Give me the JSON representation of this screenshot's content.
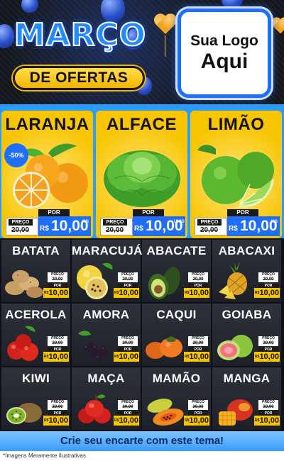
{
  "header": {
    "month": "MARÇO",
    "subtitle": "DE OFERTAS",
    "logo_line1": "Sua Logo",
    "logo_line2": "Aqui"
  },
  "featured": [
    {
      "name": "LARANJA",
      "discount": "-50%",
      "preco_label": "PREÇO",
      "old_price": "20,00",
      "por_label": "POR",
      "currency": "R$",
      "price": "10,00",
      "unit": "KG",
      "icon": "orange-fruit"
    },
    {
      "name": "ALFACE",
      "preco_label": "PREÇO",
      "old_price": "20,00",
      "por_label": "POR",
      "currency": "R$",
      "price": "10,00",
      "unit": "UNID",
      "icon": "lettuce"
    },
    {
      "name": "LIMÃO",
      "preco_label": "PREÇO",
      "old_price": "20,00",
      "por_label": "POR",
      "currency": "R$",
      "price": "10,00",
      "unit": "KG",
      "icon": "lime"
    }
  ],
  "products": [
    {
      "name": "BATATA",
      "preco_label": "PREÇO",
      "old_price": "20,00",
      "por_label": "POR",
      "currency": "R$",
      "price": "10,00",
      "icon": "potato"
    },
    {
      "name": "MARACUJÁ",
      "preco_label": "PREÇO",
      "old_price": "20,00",
      "por_label": "POR",
      "currency": "R$",
      "price": "10,00",
      "icon": "passion-fruit"
    },
    {
      "name": "ABACATE",
      "preco_label": "PREÇO",
      "old_price": "20,00",
      "por_label": "POR",
      "currency": "R$",
      "price": "10,00",
      "icon": "avocado"
    },
    {
      "name": "ABACAXI",
      "preco_label": "PREÇO",
      "old_price": "20,00",
      "por_label": "POR",
      "currency": "R$",
      "price": "10,00",
      "icon": "pineapple"
    },
    {
      "name": "ACEROLA",
      "preco_label": "PREÇO",
      "old_price": "20,00",
      "por_label": "POR",
      "currency": "R$",
      "price": "10,00",
      "icon": "acerola"
    },
    {
      "name": "AMORA",
      "preco_label": "PREÇO",
      "old_price": "20,00",
      "por_label": "POR",
      "currency": "R$",
      "price": "10,00",
      "icon": "blackberry"
    },
    {
      "name": "CAQUI",
      "preco_label": "PREÇO",
      "old_price": "20,00",
      "por_label": "POR",
      "currency": "R$",
      "price": "10,00",
      "icon": "persimmon"
    },
    {
      "name": "GOIABA",
      "preco_label": "PREÇO",
      "old_price": "20,00",
      "por_label": "POR",
      "currency": "R$",
      "price": "10,00",
      "icon": "guava"
    },
    {
      "name": "KIWI",
      "preco_label": "PREÇO",
      "old_price": "20,00",
      "por_label": "POR",
      "currency": "R$",
      "price": "10,00",
      "icon": "kiwi"
    },
    {
      "name": "MAÇA",
      "preco_label": "PREÇO",
      "old_price": "20,00",
      "por_label": "POR",
      "currency": "R$",
      "price": "10,00",
      "icon": "apple"
    },
    {
      "name": "MAMÃO",
      "preco_label": "PREÇO",
      "old_price": "20,00",
      "por_label": "POR",
      "currency": "R$",
      "price": "10,00",
      "icon": "papaya"
    },
    {
      "name": "MANGA",
      "preco_label": "PREÇO",
      "old_price": "20,00",
      "por_label": "POR",
      "currency": "R$",
      "price": "10,00",
      "icon": "mango"
    }
  ],
  "footer": {
    "cta": "Crie seu encarte com este tema!",
    "note": "*Imagens Meramente Ilustrativas"
  },
  "colors": {
    "blue": "#2a9bff",
    "yellow": "#f7c400",
    "dark": "#1d2027"
  }
}
